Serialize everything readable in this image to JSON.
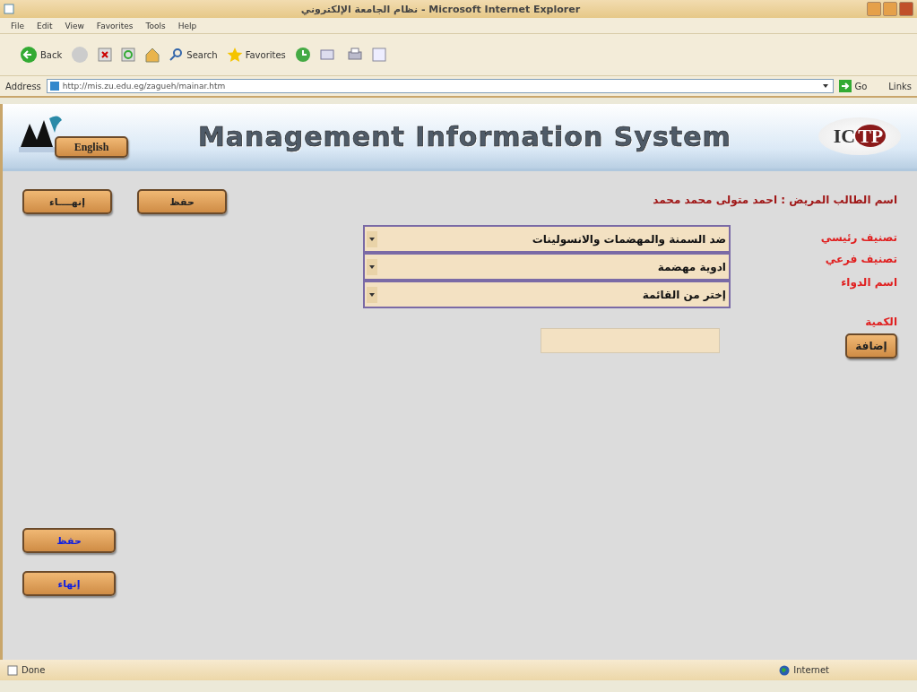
{
  "window": {
    "title": "نظام الجامعة الإلكتروني - Microsoft Internet Explorer"
  },
  "menu": {
    "file": "File",
    "edit": "Edit",
    "view": "View",
    "favorites": "Favorites",
    "tools": "Tools",
    "help": "Help"
  },
  "toolbar": {
    "back": "Back",
    "search": "Search",
    "favorites": "Favorites"
  },
  "address": {
    "label": "Address",
    "url": "http://mis.zu.edu.eg/zagueh/mainar.htm",
    "go": "Go",
    "links": "Links"
  },
  "header": {
    "language_button": "English",
    "title": "Management Information System",
    "logo_right": "ICTP"
  },
  "top_buttons": [
    "حفظ",
    "إنهــــاء"
  ],
  "patient": "اسم الطالب المريض : احمد متولى محمد محمد",
  "fields": [
    {
      "kind": "select",
      "label": "تصنيف رئيسي",
      "value": "ضد السمنة والمهضمات والانسولينات"
    },
    {
      "kind": "select",
      "label": "تصنيف فرعي",
      "value": "ادوية مهضمة"
    },
    {
      "kind": "select",
      "label": "اسم الدواء",
      "value": "إختر من القائمة"
    },
    {
      "kind": "text",
      "label": "الكمية"
    }
  ],
  "add_button": "إضافة",
  "bottom_buttons": [
    "حفظ",
    "إنهاء"
  ],
  "status_bar": {
    "text": "Done",
    "zone": "Internet"
  }
}
